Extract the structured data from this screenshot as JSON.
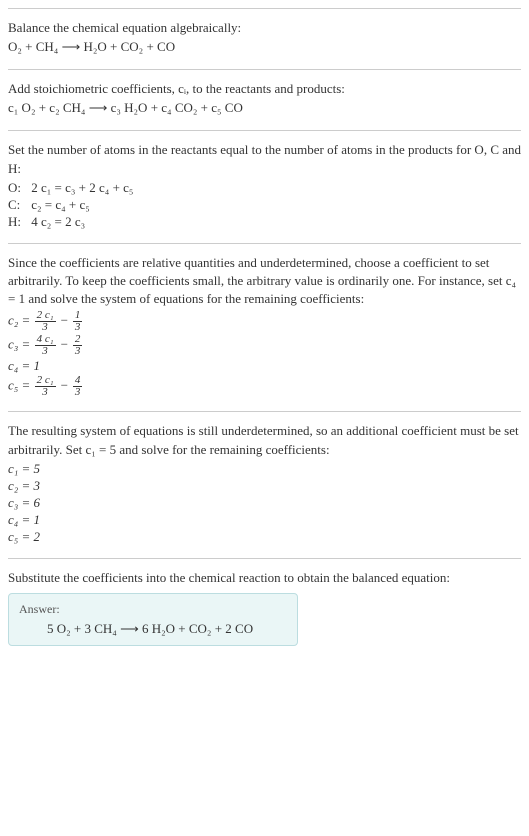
{
  "sec1": {
    "title": "Balance the chemical equation algebraically:",
    "equation": "O₂ + CH₄ ⟶ H₂O + CO₂ + CO"
  },
  "sec2": {
    "text": "Add stoichiometric coefficients, cᵢ, to the reactants and products:",
    "equation": "c₁ O₂ + c₂ CH₄ ⟶ c₃ H₂O + c₄ CO₂ + c₅ CO"
  },
  "sec3": {
    "text": "Set the number of atoms in the reactants equal to the number of atoms in the products for O, C and H:",
    "rows": [
      {
        "label": "O:",
        "eq": "2 c₁ = c₃ + 2 c₄ + c₅"
      },
      {
        "label": "C:",
        "eq": "c₂ = c₄ + c₅"
      },
      {
        "label": "H:",
        "eq": "4 c₂ = 2 c₃"
      }
    ]
  },
  "sec4": {
    "text": "Since the coefficients are relative quantities and underdetermined, choose a coefficient to set arbitrarily. To keep the coefficients small, the arbitrary value is ordinarily one. For instance, set c₄ = 1 and solve the system of equations for the remaining coefficients:",
    "c2": {
      "lhs": "c₂ =",
      "num1": "2 c₁",
      "den1": "3",
      "mid": " − ",
      "num2": "1",
      "den2": "3"
    },
    "c3": {
      "lhs": "c₃ =",
      "num1": "4 c₁",
      "den1": "3",
      "mid": " − ",
      "num2": "2",
      "den2": "3"
    },
    "c4": "c₄ = 1",
    "c5": {
      "lhs": "c₅ =",
      "num1": "2 c₁",
      "den1": "3",
      "mid": " − ",
      "num2": "4",
      "den2": "3"
    }
  },
  "sec5": {
    "text": "The resulting system of equations is still underdetermined, so an additional coefficient must be set arbitrarily. Set c₁ = 5 and solve for the remaining coefficients:",
    "rows": [
      "c₁ = 5",
      "c₂ = 3",
      "c₃ = 6",
      "c₄ = 1",
      "c₅ = 2"
    ]
  },
  "sec6": {
    "text": "Substitute the coefficients into the chemical reaction to obtain the balanced equation:",
    "answer_label": "Answer:",
    "answer_eq": "5 O₂ + 3 CH₄ ⟶ 6 H₂O + CO₂ + 2 CO"
  },
  "chart_data": {
    "type": "table",
    "title": "Balancing O₂ + CH₄ ⟶ H₂O + CO₂ + CO",
    "atom_balance_equations": {
      "O": "2 c1 = c3 + 2 c4 + c5",
      "C": "c2 = c4 + c5",
      "H": "4 c2 = 2 c3"
    },
    "parametric_solution_with_c4_eq_1": {
      "c2": "(2 c1)/3 - 1/3",
      "c3": "(4 c1)/3 - 2/3",
      "c4": 1,
      "c5": "(2 c1)/3 - 4/3"
    },
    "chosen_c1": 5,
    "coefficients": {
      "c1": 5,
      "c2": 3,
      "c3": 6,
      "c4": 1,
      "c5": 2
    },
    "balanced_equation": "5 O2 + 3 CH4 ⟶ 6 H2O + CO2 + 2 CO"
  }
}
